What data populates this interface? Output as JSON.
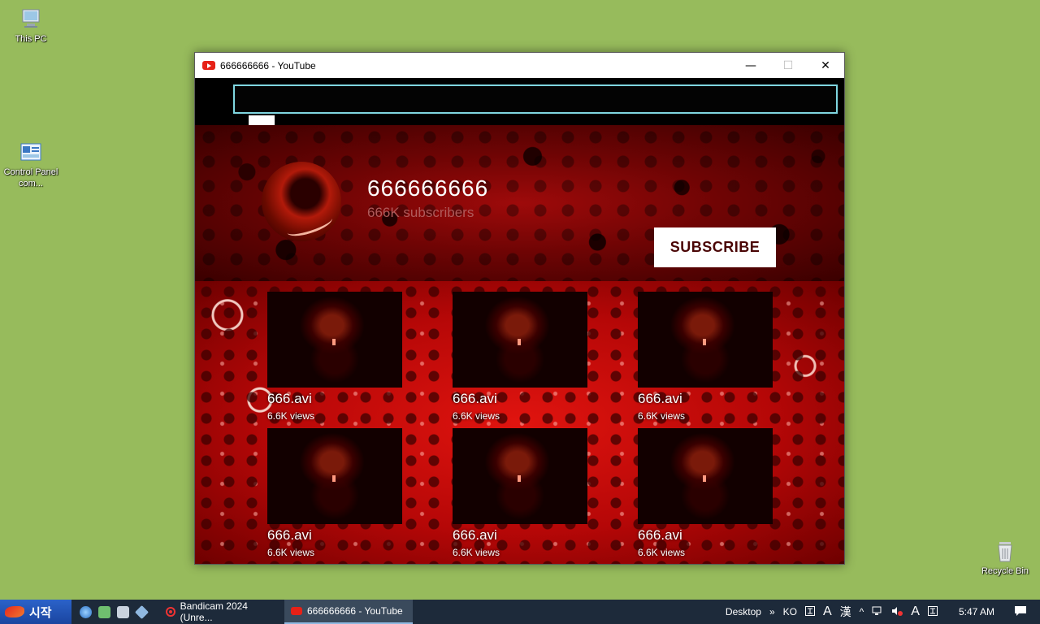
{
  "desktop": {
    "icons": [
      {
        "label": "This PC"
      },
      {
        "label": "Control Panel com..."
      },
      {
        "label": "Recycle Bin"
      }
    ]
  },
  "window": {
    "title": "666666666 - YouTube",
    "controls": {
      "minimize": "—",
      "maximize": "☐",
      "close": "✕"
    }
  },
  "channel": {
    "name": "666666666",
    "subscribers": "666K subscribers",
    "subscribe_label": "SUBSCRIBE"
  },
  "videos": [
    {
      "title": "666.avi",
      "views": "6.6K views"
    },
    {
      "title": "666.avi",
      "views": "6.6K views"
    },
    {
      "title": "666.avi",
      "views": "6.6K views"
    },
    {
      "title": "666.avi",
      "views": "6.6K views"
    },
    {
      "title": "666.avi",
      "views": "6.6K views"
    },
    {
      "title": "666.avi",
      "views": "6.6K views"
    }
  ],
  "taskbar": {
    "start_label": "시작",
    "tasks": [
      {
        "label": "Bandicam 2024 (Unre..."
      },
      {
        "label": "666666666 - YouTube"
      }
    ],
    "tray": {
      "desktop_label": "Desktop",
      "chevron": "»",
      "lang": "KO",
      "ime1": "A",
      "ime2": "漢",
      "up": "^",
      "ime3": "A",
      "time": "5:47 AM"
    }
  },
  "colors": {
    "desktop_bg": "#97bb5c",
    "search_border": "#7fd6e0",
    "subscribe_text": "#4a0505",
    "taskbar_bg": "#1d2a3a"
  }
}
